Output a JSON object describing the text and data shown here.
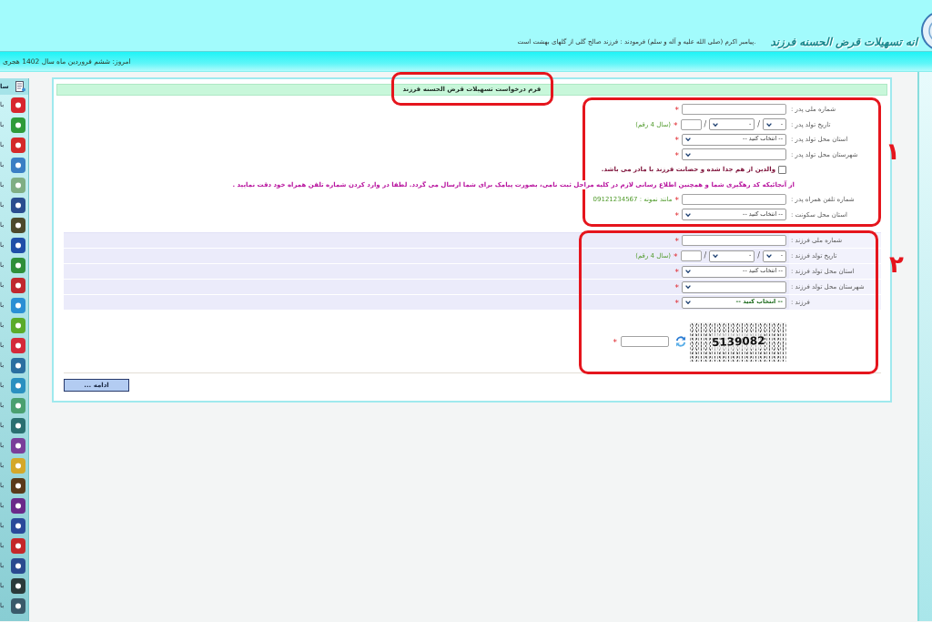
{
  "header": {
    "quote": "پیامبر اکرم (صلی الله علیه و آله و سلم) فرمودند : فرزند صالح گلی از گلهای بهشت است.",
    "logo_text": "انه تسهیلات قرض الحسنه فرزند"
  },
  "date_bar": {
    "text": "امروز: ششم فروردین ماه سال 1402 هجری"
  },
  "sidebar": {
    "title": "سا",
    "items": [
      {
        "label": "با",
        "color": "#d8262e"
      },
      {
        "label": "با",
        "color": "#2e9b3a"
      },
      {
        "label": "با",
        "color": "#d42a2a"
      },
      {
        "label": "با",
        "color": "#3a7fc4"
      },
      {
        "label": "با",
        "color": "#7fae84"
      },
      {
        "label": "با",
        "color": "#2a4d8f"
      },
      {
        "label": "با",
        "color": "#4d4a2c"
      },
      {
        "label": "با",
        "color": "#1f4fa8"
      },
      {
        "label": "با",
        "color": "#2f8f3a"
      },
      {
        "label": "با",
        "color": "#c0282e"
      },
      {
        "label": "با",
        "color": "#2a8fd4"
      },
      {
        "label": "با",
        "color": "#5aab2a"
      },
      {
        "label": "با",
        "color": "#d42a3a"
      },
      {
        "label": "با",
        "color": "#2a6fa0"
      },
      {
        "label": "با",
        "color": "#2a90c0"
      },
      {
        "label": "با",
        "color": "#4aa070"
      },
      {
        "label": "با",
        "color": "#2a6f70"
      },
      {
        "label": "با",
        "color": "#7a3f9a"
      },
      {
        "label": "با",
        "color": "#d4a82a"
      },
      {
        "label": "با",
        "color": "#5a3a1a"
      },
      {
        "label": "با",
        "color": "#6a2a8a"
      },
      {
        "label": "با",
        "color": "#2a4a9a"
      },
      {
        "label": "با",
        "color": "#c4282a"
      },
      {
        "label": "با",
        "color": "#2a4a8f"
      },
      {
        "label": "با",
        "color": "#2a3a3a"
      },
      {
        "label": "با",
        "color": "#3a5a6a"
      }
    ]
  },
  "form": {
    "title": {
      "text": "فرم درخواست تسهیلات قرض الحسنه فرزند",
      "highlighted": true
    },
    "sections": [
      {
        "highlighted": true,
        "number": "۱",
        "rows": [
          {
            "kind": "text",
            "label": "شماره ملی پدر :",
            "required_mark": "*"
          },
          {
            "kind": "date",
            "label": "تاریخ تولد پدر :",
            "day": "-",
            "month": "-",
            "separators": [
              "/",
              "/"
            ],
            "required_mark": "*",
            "hint": "(سال 4 رقم)"
          },
          {
            "kind": "select",
            "label": "استان محل تولد پدر :",
            "value": "-- انتخاب کنید --",
            "emphasized": false,
            "required_mark": "*"
          },
          {
            "kind": "select",
            "label": "شهرستان محل تولد پدر :",
            "required_mark": "*"
          },
          {
            "kind": "checkbox",
            "label": "والدین از هم جدا شده و حضانت فرزند با مادر می باشد.",
            "checked": false
          },
          {
            "kind": "notice",
            "text": "از آنجائیکه کد رهگیری شما و همچنین اطلاع رسانی لازم در کلیه مراحل ثبت نامی، بصورت پیامک برای شما ارسال می گردد. لطفا در وارد کردن شماره تلفن همراه خود دقت نمایید ."
          },
          {
            "kind": "text",
            "label": "شماره تلفن همراه پدر :",
            "required_mark": "*",
            "hint": "مانند نمونه : 09121234567"
          },
          {
            "kind": "select",
            "label": "استان محل سکونت :",
            "value": "-- انتخاب کنید --",
            "emphasized": false,
            "required_mark": "*"
          }
        ]
      },
      {
        "highlighted": true,
        "number": "۲",
        "rows": [
          {
            "kind": "text",
            "label": "شماره ملی فرزند :",
            "required_mark": "*"
          },
          {
            "kind": "date",
            "label": "تاریخ تولد فرزند :",
            "day": "-",
            "month": "-",
            "separators": [
              "/",
              "/"
            ],
            "required_mark": "*",
            "hint": "(سال 4 رقم)"
          },
          {
            "kind": "select",
            "label": "استان محل تولد فرزند :",
            "value": "-- انتخاب کنید --",
            "emphasized": false,
            "required_mark": "*"
          },
          {
            "kind": "select",
            "label": "شهرستان محل تولد فرزند :",
            "required_mark": "*"
          },
          {
            "kind": "select",
            "label": "فرزند :",
            "value": "-- انتخاب کنید --",
            "emphasized": true,
            "required_mark": "*"
          }
        ]
      }
    ],
    "captcha": {
      "code": "5139082",
      "required_mark": "*"
    },
    "submit_button": "ادامه ..."
  }
}
